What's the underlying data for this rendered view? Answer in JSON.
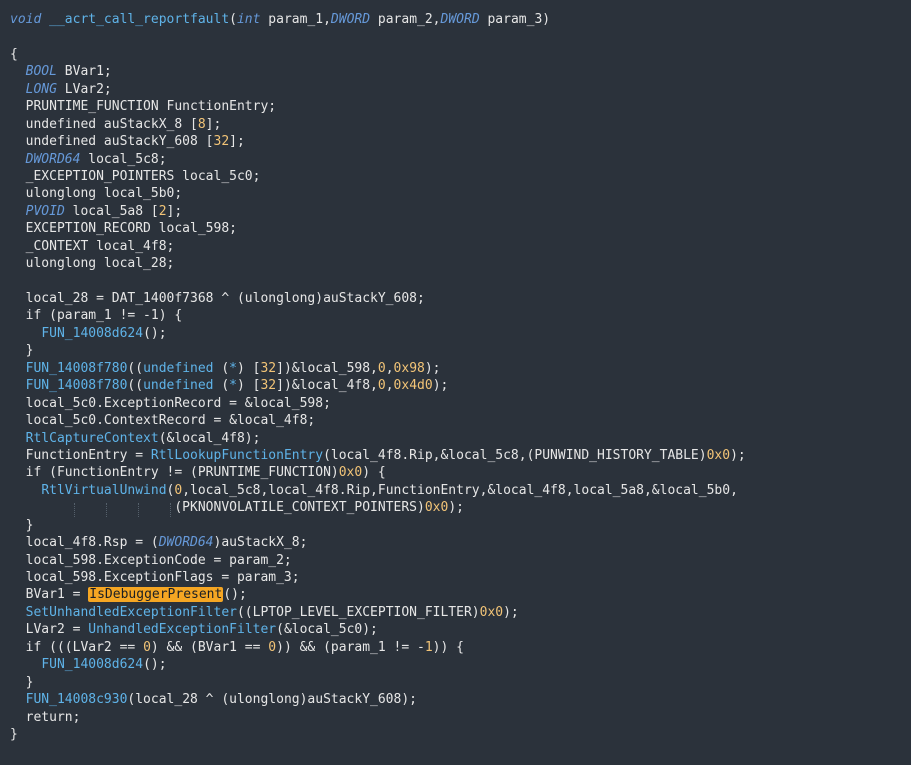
{
  "editor": {
    "language": "C (decompiled)",
    "highlighted_symbol": "IsDebuggerPresent",
    "colors": {
      "background": "#2b323b",
      "keyword": "#6699d9",
      "function": "#5fb3e8",
      "number": "#f2c477",
      "plain": "#e6e6e6",
      "highlight": "#f5a623"
    },
    "lines": [
      [
        [
          "kw",
          "void"
        ],
        [
          "fn",
          " __acrt_call_reportfault"
        ],
        [
          "pl",
          "("
        ],
        [
          "kw",
          "int"
        ],
        [
          "pl",
          " param_1,"
        ],
        [
          "kw",
          "DWORD"
        ],
        [
          "pl",
          " param_2,"
        ],
        [
          "kw",
          "DWORD"
        ],
        [
          "pl",
          " param_3)"
        ]
      ],
      [],
      [
        [
          "pl",
          "{"
        ]
      ],
      [
        [
          "pl",
          "  "
        ],
        [
          "kw",
          "BOOL"
        ],
        [
          "pl",
          " BVar1;"
        ]
      ],
      [
        [
          "pl",
          "  "
        ],
        [
          "kw",
          "LONG"
        ],
        [
          "pl",
          " LVar2;"
        ]
      ],
      [
        [
          "pl",
          "  PRUNTIME_FUNCTION FunctionEntry;"
        ]
      ],
      [
        [
          "pl",
          "  undefined auStackX_8 ["
        ],
        [
          "num",
          "8"
        ],
        [
          "pl",
          "];"
        ]
      ],
      [
        [
          "pl",
          "  undefined auStackY_608 ["
        ],
        [
          "num",
          "32"
        ],
        [
          "pl",
          "];"
        ]
      ],
      [
        [
          "pl",
          "  "
        ],
        [
          "kw",
          "DWORD64"
        ],
        [
          "pl",
          " local_5c8;"
        ]
      ],
      [
        [
          "pl",
          "  _EXCEPTION_POINTERS local_5c0;"
        ]
      ],
      [
        [
          "pl",
          "  ulonglong local_5b0;"
        ]
      ],
      [
        [
          "pl",
          "  "
        ],
        [
          "kw",
          "PVOID"
        ],
        [
          "pl",
          " local_5a8 ["
        ],
        [
          "num",
          "2"
        ],
        [
          "pl",
          "];"
        ]
      ],
      [
        [
          "pl",
          "  EXCEPTION_RECORD local_598;"
        ]
      ],
      [
        [
          "pl",
          "  _CONTEXT local_4f8;"
        ]
      ],
      [
        [
          "pl",
          "  ulonglong local_28;"
        ]
      ],
      [],
      [
        [
          "pl",
          "  local_28 = DAT_1400f7368 ^ (ulonglong)auStackY_608;"
        ]
      ],
      [
        [
          "pl",
          "  if (param_1 != -1) {"
        ]
      ],
      [
        [
          "pl",
          "    "
        ],
        [
          "fn",
          "FUN_14008d624"
        ],
        [
          "pl",
          "();"
        ]
      ],
      [
        [
          "pl",
          "  }"
        ]
      ],
      [
        [
          "pl",
          "  "
        ],
        [
          "fn",
          "FUN_14008f780"
        ],
        [
          "pl",
          "(("
        ],
        [
          "fn",
          "undefined"
        ],
        [
          "pl",
          " ("
        ],
        [
          "fn",
          "*"
        ],
        [
          "pl",
          ") ["
        ],
        [
          "num",
          "32"
        ],
        [
          "pl",
          "])&local_598,"
        ],
        [
          "num",
          "0"
        ],
        [
          "pl",
          ","
        ],
        [
          "num",
          "0x98"
        ],
        [
          "pl",
          ");"
        ]
      ],
      [
        [
          "pl",
          "  "
        ],
        [
          "fn",
          "FUN_14008f780"
        ],
        [
          "pl",
          "(("
        ],
        [
          "fn",
          "undefined"
        ],
        [
          "pl",
          " ("
        ],
        [
          "fn",
          "*"
        ],
        [
          "pl",
          ") ["
        ],
        [
          "num",
          "32"
        ],
        [
          "pl",
          "])&local_4f8,"
        ],
        [
          "num",
          "0"
        ],
        [
          "pl",
          ","
        ],
        [
          "num",
          "0x4d0"
        ],
        [
          "pl",
          ");"
        ]
      ],
      [
        [
          "pl",
          "  local_5c0.ExceptionRecord = &local_598;"
        ]
      ],
      [
        [
          "pl",
          "  local_5c0.ContextRecord = &local_4f8;"
        ]
      ],
      [
        [
          "pl",
          "  "
        ],
        [
          "fn",
          "RtlCaptureContext"
        ],
        [
          "pl",
          "(&local_4f8);"
        ]
      ],
      [
        [
          "pl",
          "  FunctionEntry = "
        ],
        [
          "fn",
          "RtlLookupFunctionEntry"
        ],
        [
          "pl",
          "(local_4f8.Rip,&local_5c8,(PUNWIND_HISTORY_TABLE)"
        ],
        [
          "num",
          "0x0"
        ],
        [
          "pl",
          ");"
        ]
      ],
      [
        [
          "pl",
          "  if (FunctionEntry != (PRUNTIME_FUNCTION)"
        ],
        [
          "num",
          "0x0"
        ],
        [
          "pl",
          ") {"
        ]
      ],
      [
        [
          "pl",
          "    "
        ],
        [
          "fn",
          "RtlVirtualUnwind"
        ],
        [
          "pl",
          "("
        ],
        [
          "num",
          "0"
        ],
        [
          "pl",
          ",local_5c8,local_4f8.Rip,FunctionEntry,&local_4f8,local_5a8,&local_5b0,"
        ]
      ],
      [
        [
          "pl",
          "                     (PKNONVOLATILE_CONTEXT_POINTERS)"
        ],
        [
          "num",
          "0x0"
        ],
        [
          "pl",
          ");"
        ]
      ],
      [
        [
          "pl",
          "  }"
        ]
      ],
      [
        [
          "pl",
          "  local_4f8.Rsp = ("
        ],
        [
          "kw",
          "DWORD64"
        ],
        [
          "pl",
          ")auStackX_8;"
        ]
      ],
      [
        [
          "pl",
          "  local_598.ExceptionCode = param_2;"
        ]
      ],
      [
        [
          "pl",
          "  local_598.ExceptionFlags = param_3;"
        ]
      ],
      [
        [
          "pl",
          "  BVar1 = "
        ],
        [
          "hl",
          "IsDebuggerPresent"
        ],
        [
          "pl",
          "();"
        ]
      ],
      [
        [
          "pl",
          "  "
        ],
        [
          "fn",
          "SetUnhandledExceptionFilter"
        ],
        [
          "pl",
          "((LPTOP_LEVEL_EXCEPTION_FILTER)"
        ],
        [
          "num",
          "0x0"
        ],
        [
          "pl",
          ");"
        ]
      ],
      [
        [
          "pl",
          "  LVar2 = "
        ],
        [
          "fn",
          "UnhandledExceptionFilter"
        ],
        [
          "pl",
          "(&local_5c0);"
        ]
      ],
      [
        [
          "pl",
          "  if (((LVar2 == "
        ],
        [
          "num",
          "0"
        ],
        [
          "pl",
          ") && (BVar1 == "
        ],
        [
          "num",
          "0"
        ],
        [
          "pl",
          ")) && (param_1 != -"
        ],
        [
          "num",
          "1"
        ],
        [
          "pl",
          ")) {"
        ]
      ],
      [
        [
          "pl",
          "    "
        ],
        [
          "fn",
          "FUN_14008d624"
        ],
        [
          "pl",
          "();"
        ]
      ],
      [
        [
          "pl",
          "  }"
        ]
      ],
      [
        [
          "pl",
          "  "
        ],
        [
          "fn",
          "FUN_14008c930"
        ],
        [
          "pl",
          "(local_28 ^ (ulonglong)auStackY_608);"
        ]
      ],
      [
        [
          "pl",
          "  return;"
        ]
      ],
      [
        [
          "pl",
          "}"
        ]
      ]
    ]
  }
}
